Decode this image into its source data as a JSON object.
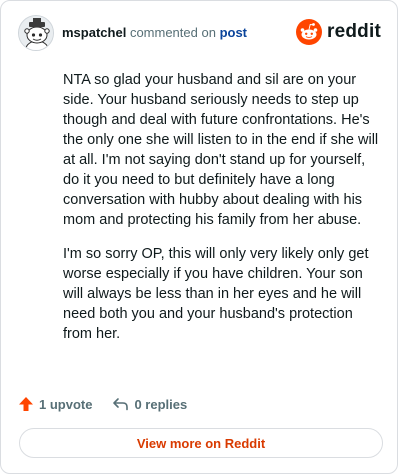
{
  "header": {
    "username": "mspatchel",
    "action_text": "commented on",
    "link_text": "post",
    "logo_text": "reddit"
  },
  "comment": {
    "paragraphs": [
      "NTA so glad your husband and sil are on your side. Your husband seriously needs to step up though and deal with future confrontations. He's the only one she will listen to in the end if she will at all. I'm not saying don't stand up for yourself, do it you need to but definitely have a long conversation with hubby about dealing with his mom and protecting his family from her abuse.",
      "I'm so sorry OP, this will only very likely only get worse especially if you have children. Your son will always be less than in her eyes and he will need both you and your husband's protection from her."
    ]
  },
  "actions": {
    "upvote_label": "1 upvote",
    "reply_label": "0 replies"
  },
  "footer": {
    "view_more_label": "View more on Reddit"
  },
  "colors": {
    "brand": "#ff4500",
    "link": "#0a449b",
    "cta_text": "#d93a00"
  },
  "icons": {
    "avatar": "snoo-avatar",
    "logo": "reddit-snoo-icon",
    "upvote": "upvote-arrow-icon",
    "reply": "reply-arrow-icon"
  }
}
